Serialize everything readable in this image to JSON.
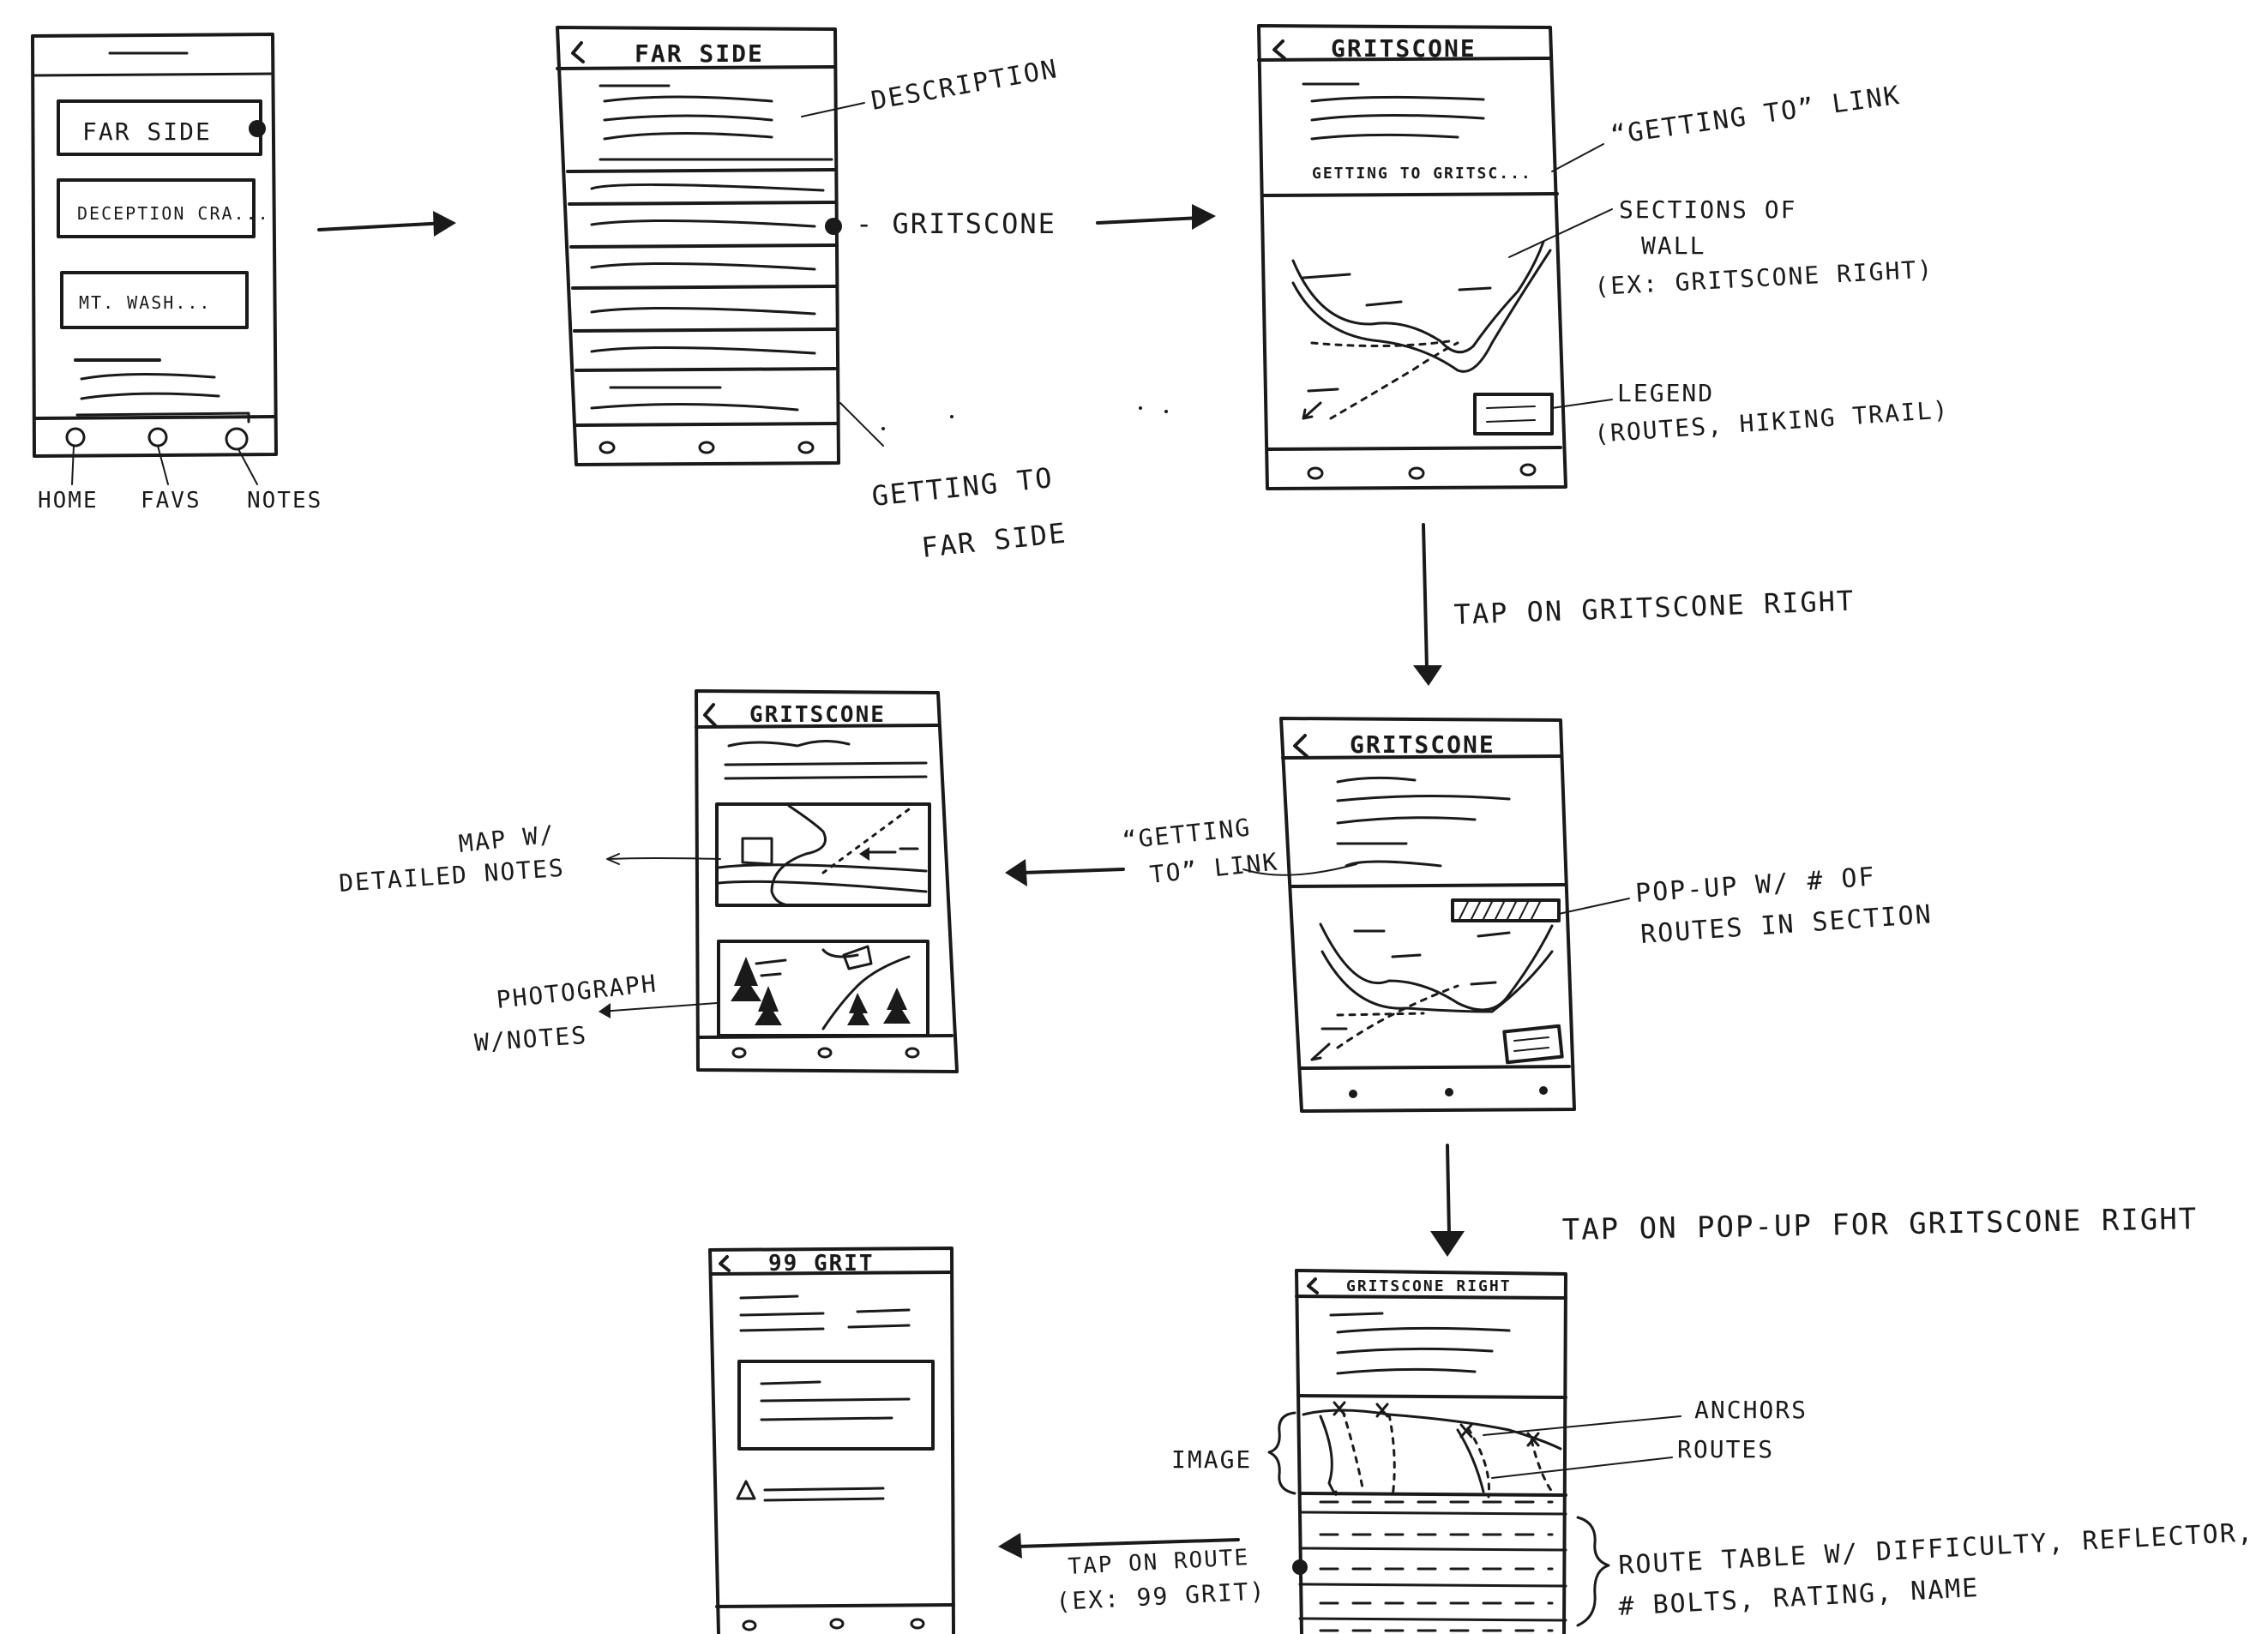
{
  "screens": {
    "home": {
      "buttons": [
        "FAR SIDE",
        "DECEPTION CRA...",
        "MT. WASH..."
      ],
      "tabs": [
        "HOME",
        "FAVS",
        "NOTES"
      ]
    },
    "far_side": {
      "title": "FAR SIDE"
    },
    "gritscone": {
      "title": "GRITSCONE",
      "link": "GETTING TO GRITSC..."
    },
    "gritscone_popup": {
      "title": "GRITSCONE"
    },
    "gritscone_detail": {
      "title": "GRITSCONE"
    },
    "gritscone_right": {
      "title": "GRITSCONE RIGHT"
    },
    "route_99grit": {
      "title": "99 GRIT"
    }
  },
  "annotations": {
    "description": "DESCRIPTION",
    "gritscone": "- GRITSCONE",
    "getting_to_far_side_1": "GETTING TO",
    "getting_to_far_side_2": "FAR SIDE",
    "getting_to_link": "“GETTING TO” LINK",
    "sections_1": "SECTIONS OF",
    "sections_2": "WALL",
    "sections_3": "(EX: GRITSCONE RIGHT)",
    "legend_1": "LEGEND",
    "legend_2": "(ROUTES, HIKING TRAIL)",
    "tap_gritscone_right": "TAP ON GRITSCONE RIGHT",
    "map_notes_1": "MAP W/",
    "map_notes_2": "DETAILED NOTES",
    "photo_notes_1": "PHOTOGRAPH",
    "photo_notes_2": "W/NOTES",
    "getting_to_link2_1": "“GETTING",
    "getting_to_link2_2": "TO” LINK",
    "popup_1": "POP-UP W/ # OF",
    "popup_2": "ROUTES IN SECTION",
    "tap_popup": "TAP ON POP-UP FOR GRITSCONE RIGHT",
    "anchors": "ANCHORS",
    "routes": "ROUTES",
    "image": "IMAGE",
    "route_table_1": "ROUTE TABLE W/ DIFFICULTY, REFLECTOR,",
    "route_table_2": "# BOLTS, RATING, NAME",
    "tap_route_1": "TAP ON ROUTE",
    "tap_route_2": "(EX: 99 GRIT)"
  }
}
